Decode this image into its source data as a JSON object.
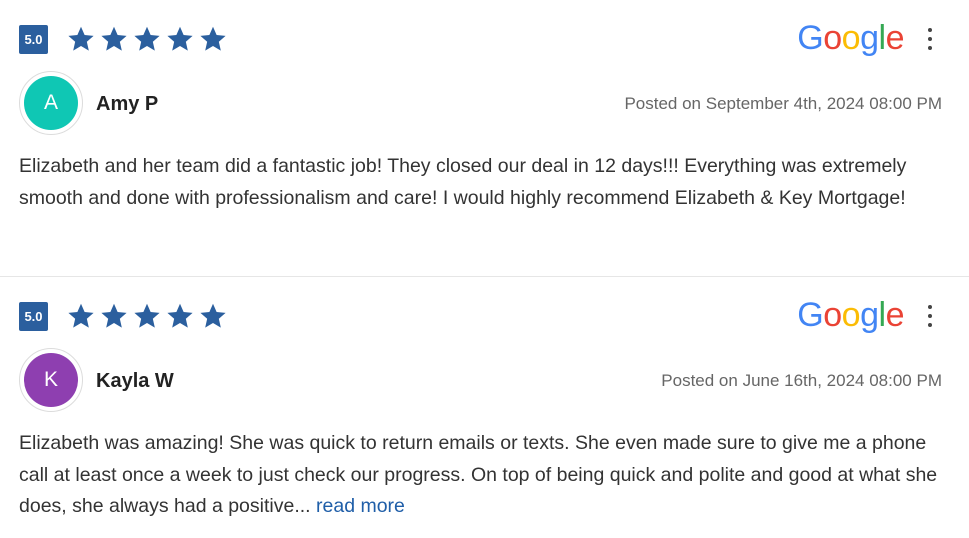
{
  "reviews": [
    {
      "rating_label": "5.0",
      "rating": 5,
      "rating_max": 5,
      "source": "Google",
      "avatar_initial": "A",
      "avatar_color": "#0fc7b4",
      "name": "Amy P",
      "posted": "Posted on September 4th, 2024 08:00 PM",
      "text": "Elizabeth and her team did a fantastic job! They closed our deal in 12 days!!! Everything was extremely smooth and done with professionalism and care! I would highly recommend Elizabeth & Key Mortgage!"
    },
    {
      "rating_label": "5.0",
      "rating": 5,
      "rating_max": 5,
      "source": "Google",
      "avatar_initial": "K",
      "avatar_color": "#8e3fb0",
      "name": "Kayla W",
      "posted": "Posted on June 16th, 2024 08:00 PM",
      "text": "Elizabeth was amazing! She was quick to return emails or texts. She even made sure to give me a phone call at least once a week to just check our progress. On top of being quick and polite and good at what she does, she always had a positive...",
      "read_more": "read more"
    }
  ],
  "colors": {
    "star": "#2b5f9e",
    "badge": "#2b5f9e",
    "link": "#1f5ea8"
  },
  "icons": {
    "rating": "star-icon",
    "menu": "more-vertical-icon",
    "source": "google-logo"
  }
}
